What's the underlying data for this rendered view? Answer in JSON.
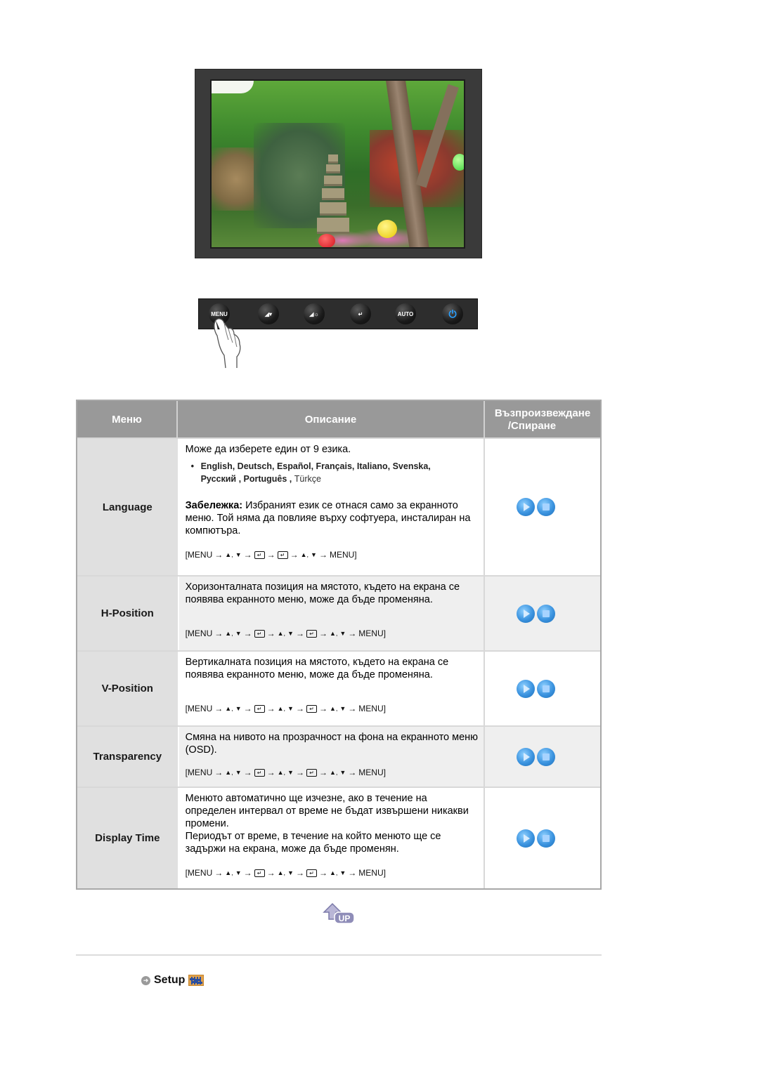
{
  "illustration": {
    "monitor_image_alt": "Monitor displaying garden with pagoda and lanterns",
    "panel_buttons": [
      {
        "name": "menu",
        "label": "MENU",
        "icon": "menu-icon"
      },
      {
        "name": "brightness-down",
        "label": "◢▾",
        "icon": "contrast-down-icon"
      },
      {
        "name": "brightness",
        "label": "◢☼",
        "icon": "brightness-icon"
      },
      {
        "name": "enter",
        "label": "↵",
        "icon": "enter-icon"
      },
      {
        "name": "auto",
        "label": "AUTO",
        "icon": "auto-icon"
      },
      {
        "name": "power",
        "label": "⏻",
        "icon": "power-icon"
      }
    ]
  },
  "table": {
    "headers": {
      "menu": "Меню",
      "description": "Описание",
      "playback_line1": "Възпроизвеждане",
      "playback_line2": "/Спиране"
    },
    "rows": [
      {
        "menu": "Language",
        "intro": "Може да изберете един от 9 езика.",
        "languages_line1": "English, Deutsch, Español, Français,  Italiano, Svenska,",
        "languages_line2": "Русский , Português , ",
        "languages_last": "Türkçe",
        "note_label": "Забележка:",
        "note_text": " Избраният език се отнася само за екранното меню. Той няма да повлияе върху софтуера, инсталиран на компютъра.",
        "sequence": [
          "[MENU",
          "→",
          "▲,",
          "▼",
          "→",
          "↵",
          "→",
          "↵",
          "→",
          "▲,",
          "▼",
          "→",
          "MENU]"
        ]
      },
      {
        "menu": "H-Position",
        "text": "Хоризонталната позиция на мястото, където на екрана се появява екранното меню, може да бъде променяна.",
        "sequence": [
          "[MENU",
          "→",
          "▲,",
          "▼",
          "→",
          "↵",
          "→",
          "▲,",
          "▼",
          "→",
          "↵",
          "→",
          "▲,",
          "▼",
          "→",
          "MENU]"
        ]
      },
      {
        "menu": "V-Position",
        "text": "Вертикалната позиция на мястото, където на екрана се появява екранното меню, може да бъде променяна.",
        "sequence": [
          "[MENU",
          "→",
          "▲,",
          "▼",
          "→",
          "↵",
          "→",
          "▲,",
          "▼",
          "→",
          "↵",
          "→",
          "▲,",
          "▼",
          "→",
          "MENU]"
        ]
      },
      {
        "menu": "Transparency",
        "text": "Смяна на нивото на прозрачност на фона на екранното меню (OSD).",
        "sequence": [
          "[MENU",
          "→",
          "▲,",
          "▼",
          "→",
          "↵",
          "→",
          "▲,",
          "▼",
          "→",
          "↵",
          "→",
          "▲,",
          "▼",
          "→",
          "MENU]"
        ]
      },
      {
        "menu": "Display Time",
        "text1": "Менюто автоматично ще изчезне, ако в течение на определен интервал от време не бъдат извършени никакви промени.",
        "text2": "Периодът от време, в течение на който менюто ще се задържи на екрана, може да бъде променян.",
        "sequence": [
          "[MENU",
          "→",
          "▲,",
          "▼",
          "→",
          "↵",
          "→",
          "▲,",
          "▼",
          "→",
          "↵",
          "→",
          "▲,",
          "▼",
          "→",
          "MENU]"
        ]
      }
    ],
    "controls": {
      "play": "play-icon",
      "stop": "stop-icon"
    }
  },
  "footer": {
    "up_label": "UP",
    "setup_label": "Setup"
  },
  "colors": {
    "header_bg": "#999999",
    "menu_cell_bg": "#e0e0e0",
    "alt_row_bg": "#efefef",
    "control_blue": "#3b93df"
  }
}
